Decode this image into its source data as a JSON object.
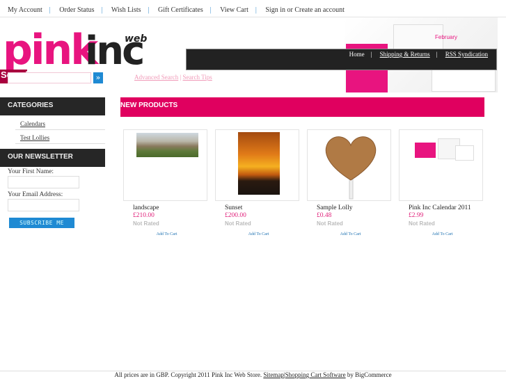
{
  "top_nav": [
    "My Account",
    "Order Status",
    "Wish Lists",
    "Gift Certificates",
    "View Cart",
    "Sign in or Create an account"
  ],
  "logo": {
    "text": "pink inc",
    "sup": "web"
  },
  "promo": {
    "month": "February"
  },
  "page_nav": [
    "Home",
    "Shipping & Returns",
    "RSS Syndication"
  ],
  "search": {
    "label": "Search",
    "button": "»",
    "advanced": "Advanced Search",
    "tips": "Search Tips",
    "sep": "|"
  },
  "categories": {
    "title": "CATEGORIES",
    "items": [
      "Calendars",
      "Test Lollies"
    ]
  },
  "newsletter": {
    "title": "OUR NEWSLETTER",
    "first_name_label": "Your First Name:",
    "email_label": "Your Email Address:",
    "button": "SUBSCRIBE ME"
  },
  "new_products": {
    "title": "NEW PRODUCTS",
    "items": [
      {
        "name": "landscape",
        "price": "£210.00",
        "rating": "Not Rated",
        "cart": "Add To Cart"
      },
      {
        "name": "Sunset",
        "price": "£200.00",
        "rating": "Not Rated",
        "cart": "Add To Cart"
      },
      {
        "name": "Sample Lolly",
        "price": "£0.48",
        "rating": "Not Rated",
        "cart": "Add To Cart"
      },
      {
        "name": "Pink Inc Calendar 2011",
        "price": "£2.99",
        "rating": "Not Rated",
        "cart": "Add To Cart"
      }
    ]
  },
  "footer": {
    "pre": "All prices are in GBP. Copyright 2011 Pink Inc Web Store.",
    "sitemap": "Sitemap",
    "sep": "|",
    "software": "Shopping Cart Software",
    "post": "by BigCommerce"
  }
}
